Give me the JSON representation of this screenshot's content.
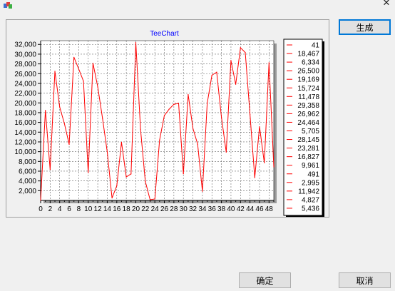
{
  "window": {
    "icon": "app-icon",
    "close_icon": "close-icon",
    "close_glyph": "✕"
  },
  "buttons": {
    "generate": "生成",
    "ok": "确定",
    "cancel": "取消"
  },
  "colors": {
    "series": "#ff0000",
    "title": "#0000ff",
    "panel_bg": "#f0f0f0",
    "plot_bg": "#ffffff"
  },
  "chart_data": {
    "type": "line",
    "title": "TeeChart",
    "xlabel": "",
    "ylabel": "",
    "x": [
      0,
      1,
      2,
      3,
      4,
      5,
      6,
      7,
      8,
      9,
      10,
      11,
      12,
      13,
      14,
      15,
      16,
      17,
      18,
      19,
      20,
      21,
      22,
      23,
      24,
      25,
      26,
      27,
      28,
      29,
      30,
      31,
      32,
      33,
      34,
      35,
      36,
      37,
      38,
      39,
      40,
      41,
      42,
      43,
      44,
      45,
      46,
      47,
      48,
      49
    ],
    "values": [
      41,
      18467,
      6334,
      26500,
      19169,
      15724,
      11478,
      29358,
      26962,
      24464,
      5705,
      28145,
      23281,
      16827,
      9961,
      491,
      2995,
      11942,
      4827,
      5436,
      32391,
      14604,
      3902,
      153,
      292,
      12382,
      17421,
      18716,
      19718,
      19895,
      5447,
      21726,
      14771,
      11538,
      1869,
      19912,
      25667,
      26299,
      17035,
      9894,
      28703,
      23811,
      31322,
      30333,
      17673,
      4664,
      15141,
      7711,
      28253,
      6868
    ],
    "x_ticks": [
      "0",
      "2",
      "4",
      "6",
      "8",
      "10",
      "12",
      "14",
      "16",
      "18",
      "20",
      "22",
      "24",
      "26",
      "28",
      "30",
      "32",
      "34",
      "36",
      "38",
      "40",
      "42",
      "44",
      "46",
      "48"
    ],
    "y_ticks": [
      "2,000",
      "4,000",
      "6,000",
      "8,000",
      "10,000",
      "12,000",
      "14,000",
      "16,000",
      "18,000",
      "20,000",
      "22,000",
      "24,000",
      "26,000",
      "28,000",
      "30,000",
      "32,000"
    ],
    "legend": [
      "41",
      "18,467",
      "6,334",
      "26,500",
      "19,169",
      "15,724",
      "11,478",
      "29,358",
      "26,962",
      "24,464",
      "5,705",
      "28,145",
      "23,281",
      "16,827",
      "9,961",
      "491",
      "2,995",
      "11,942",
      "4,827",
      "5,436"
    ],
    "xlim": [
      0,
      49
    ],
    "ylim": [
      0,
      32767
    ],
    "grid": true,
    "legend_position": "right"
  }
}
